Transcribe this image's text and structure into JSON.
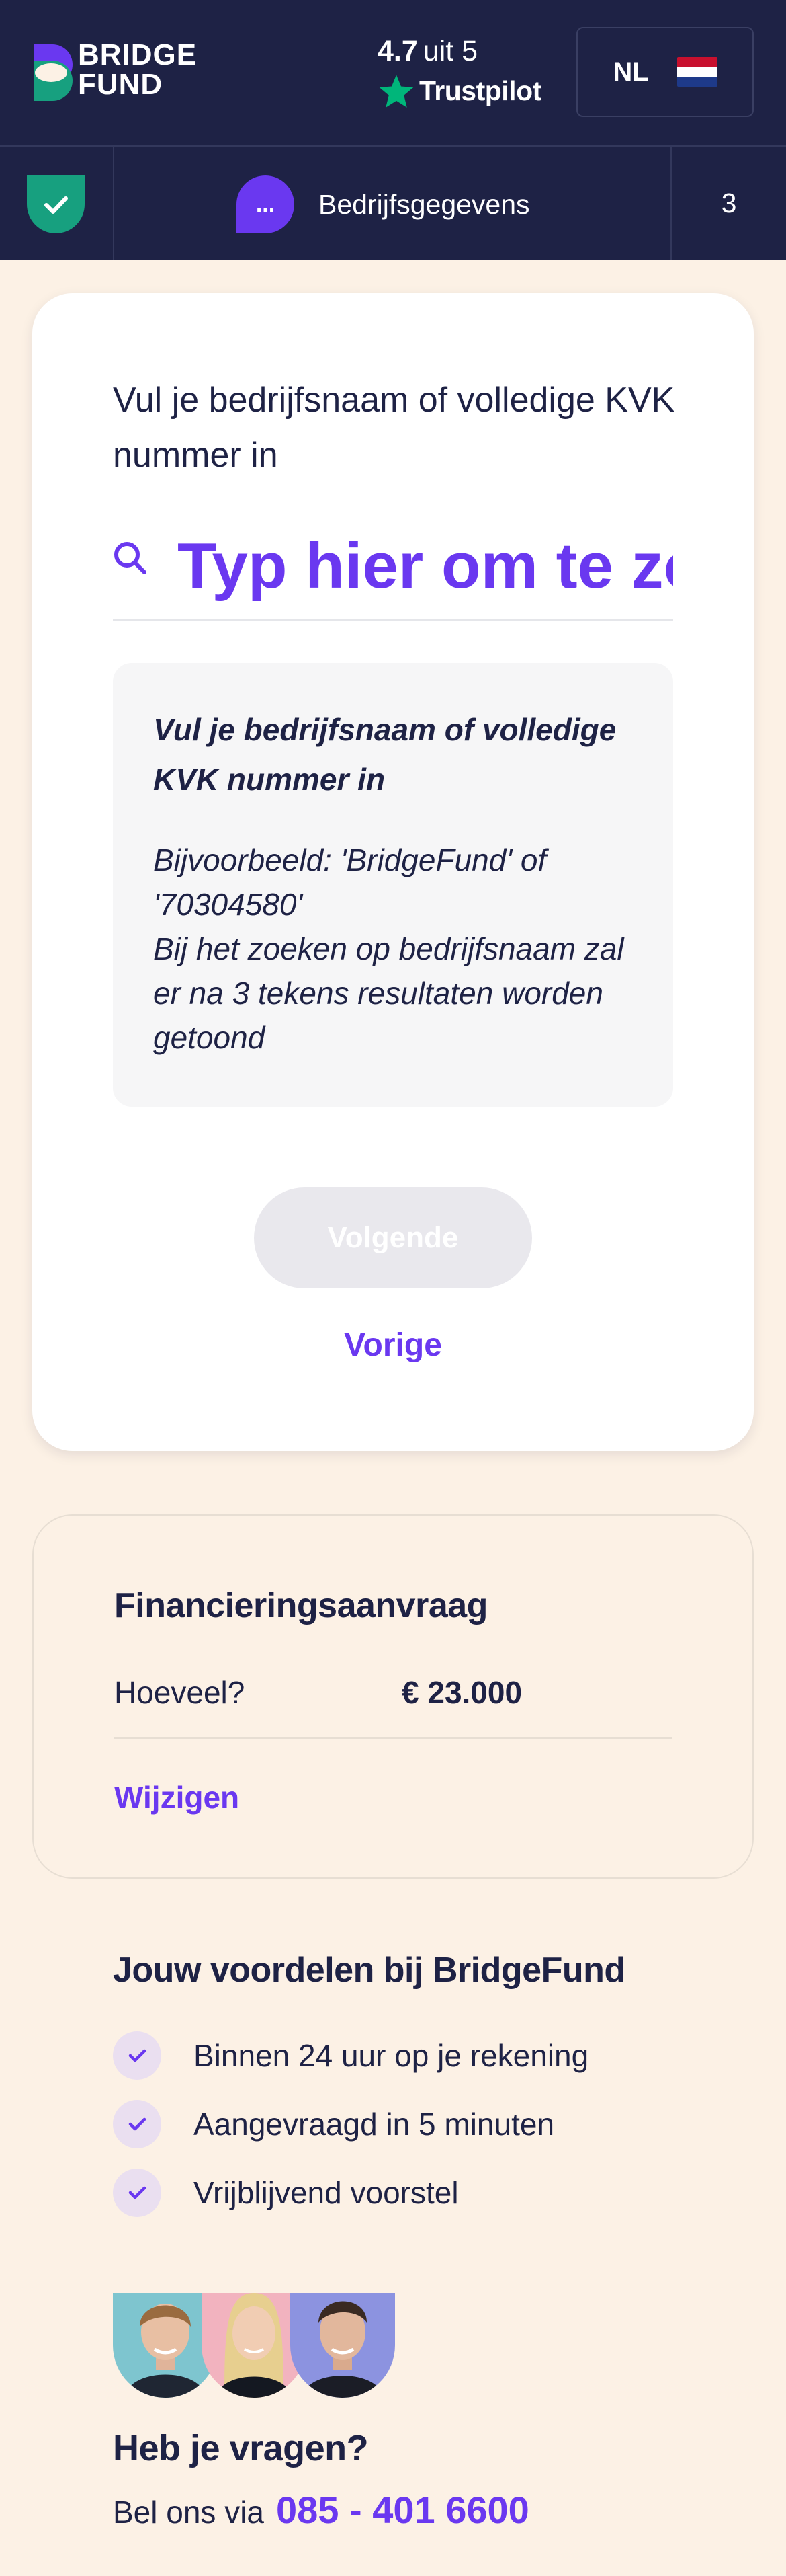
{
  "header": {
    "logo_line1": "BRIDGE",
    "logo_line2": "FUND",
    "trustpilot_score": "4.7",
    "trustpilot_suffix": "uit 5",
    "trustpilot_brand": "Trustpilot",
    "language": "NL"
  },
  "stepper": {
    "step1_state": "completed",
    "step2_icon": "...",
    "step2_label": "Bedrijfsgegevens",
    "step3_number": "3"
  },
  "form": {
    "title": "Vul je bedrijfsnaam of volledige KVK nummer in",
    "search_placeholder": "Typ hier om te zoeken",
    "hint_title": "Vul je bedrijfsnaam of volledige KVK nummer in",
    "hint_example": "Bijvoorbeeld: 'BridgeFund' of '70304580'",
    "hint_note": "Bij het zoeken op bedrijfsnaam zal er na 3 tekens resultaten worden getoond",
    "next_label": "Volgende",
    "prev_label": "Vorige"
  },
  "summary": {
    "title": "Financieringsaanvraag",
    "amount_label": "Hoeveel?",
    "amount_value": "€ 23.000",
    "edit_link": "Wijzigen"
  },
  "benefits": {
    "title": "Jouw voordelen bij BridgeFund",
    "items": [
      {
        "label": "Binnen 24 uur op je rekening"
      },
      {
        "label": "Aangevraagd in 5 minuten"
      },
      {
        "label": "Vrijblijvend voorstel"
      }
    ]
  },
  "contact": {
    "title": "Heb je vragen?",
    "prefix": "Bel ons via",
    "phone": "085 - 401 6600"
  },
  "colors": {
    "navy": "#1e2245",
    "accent": "#6a38f0",
    "green": "#17a07f",
    "cream": "#fcf1e5"
  }
}
